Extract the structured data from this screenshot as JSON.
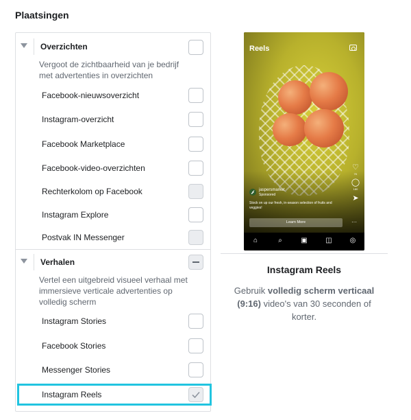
{
  "page": {
    "title": "Plaatsingen"
  },
  "groups": [
    {
      "title": "Overzichten",
      "description": "Vergoot de zichtbaarheid van je bedrijf met advertenties in overzichten",
      "items": [
        {
          "label": "Facebook-nieuwsoverzicht",
          "state": "unchecked"
        },
        {
          "label": "Instagram-overzicht",
          "state": "unchecked"
        },
        {
          "label": "Facebook Marketplace",
          "state": "unchecked"
        },
        {
          "label": "Facebook-video-overzichten",
          "state": "unchecked"
        },
        {
          "label": "Rechterkolom op Facebook",
          "state": "disabled"
        },
        {
          "label": "Instagram Explore",
          "state": "unchecked"
        },
        {
          "label": "Postvak IN Messenger",
          "state": "disabled"
        }
      ]
    },
    {
      "title": "Verhalen",
      "description": "Vertel een uitgebreid visueel verhaal met immersieve verticale advertenties op volledig scherm",
      "state": "indeterminate",
      "items": [
        {
          "label": "Instagram Stories",
          "state": "unchecked"
        },
        {
          "label": "Facebook Stories",
          "state": "unchecked"
        },
        {
          "label": "Messenger Stories",
          "state": "unchecked"
        },
        {
          "label": "Instagram Reels",
          "state": "checked",
          "highlighted": true
        }
      ]
    }
  ],
  "preview": {
    "title": "Instagram Reels",
    "desc_prefix": "Gebruik ",
    "desc_bold": "volledig scherm verticaal (9:16)",
    "desc_suffix": " video's van 30 seconden of korter.",
    "phone": {
      "header": "Reels",
      "account": "jaspersmarket",
      "sponsored": "Sponsored",
      "caption": "Stock on up our fresh, in-season selection of fruits and veggies!",
      "cta": "Learn More",
      "likes": "7K",
      "comments": "180",
      "more": "···"
    }
  },
  "colors": {
    "highlight": "#21c4e0",
    "border": "#dddfe2",
    "muted_text": "#606770"
  },
  "icons": [
    "collapse-triangle-icon",
    "camera-icon",
    "heart-icon",
    "comment-icon",
    "share-icon",
    "home-icon",
    "search-icon",
    "reels-icon",
    "shop-icon",
    "profile-icon",
    "checkmark-icon"
  ]
}
